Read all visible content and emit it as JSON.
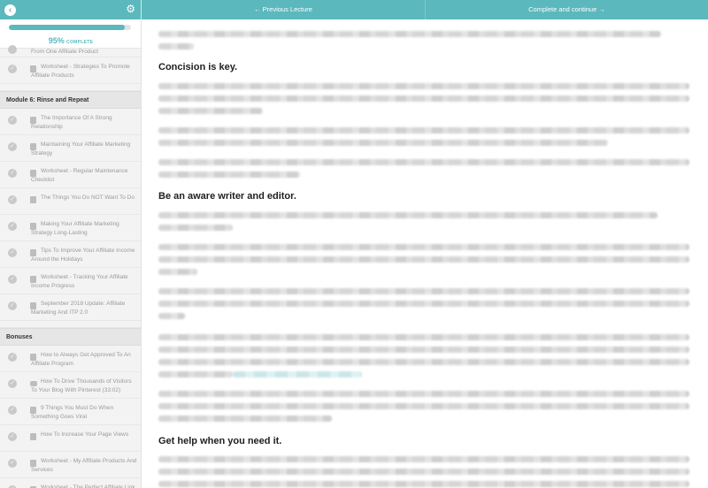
{
  "sidebar": {
    "progress": {
      "percent_label": "95%",
      "complete_label": "COMPLETE",
      "fraction": 0.95
    },
    "items": [
      {
        "kind": "partial",
        "title": "From One Affiliate Product"
      },
      {
        "kind": "lesson",
        "type": "text",
        "title": "Worksheet - Strategies To Promote Affiliate Products"
      },
      {
        "kind": "gap"
      },
      {
        "kind": "module",
        "title": "Module 6: Rinse and Repeat"
      },
      {
        "kind": "lesson",
        "type": "text",
        "title": "The Importance Of A Strong Relationship"
      },
      {
        "kind": "lesson",
        "type": "text",
        "title": "Maintaining Your Affiliate Marketing Strategy"
      },
      {
        "kind": "lesson",
        "type": "text",
        "title": "Worksheet - Regular Maintenance Checklist"
      },
      {
        "kind": "lesson",
        "type": "text",
        "title": "The Things You Do NOT Want To Do"
      },
      {
        "kind": "lesson",
        "type": "text",
        "title": "Making Your Affiliate Marketing Strategy Long-Lasting"
      },
      {
        "kind": "lesson",
        "type": "text",
        "title": "Tips To Improve Your Affiliate Income Around the Holidays"
      },
      {
        "kind": "lesson",
        "type": "text",
        "title": "Worksheet - Tracking Your Affiliate Income Progress"
      },
      {
        "kind": "lesson",
        "type": "text",
        "title": "September 2018 Update: Affiliate Marketing And ITP 2.0"
      },
      {
        "kind": "gap"
      },
      {
        "kind": "module",
        "title": "Bonuses"
      },
      {
        "kind": "lesson",
        "type": "text",
        "title": "How to Always Get Approved To An Affiliate Program"
      },
      {
        "kind": "lesson",
        "type": "video",
        "title": "How To Drive Thousands of Visitors To Your Blog With Pinterest (33:02)"
      },
      {
        "kind": "lesson",
        "type": "text",
        "title": "9 Things You Must Do When Something Goes Viral"
      },
      {
        "kind": "lesson",
        "type": "text",
        "title": "How To Increase Your Page Views"
      },
      {
        "kind": "lesson",
        "type": "text",
        "title": "Worksheet - My Affiliate Products And Services"
      },
      {
        "kind": "lesson",
        "type": "text",
        "title": "Worksheet - The Perfect Affiliate Link Checklist"
      }
    ]
  },
  "topbar": {
    "prev_label": "← Previous Lecture",
    "next_label": "Complete and continue →"
  },
  "content": {
    "headings": [
      "Concision is key.",
      "Be an aware writer and editor.",
      "Get help when you need it."
    ]
  },
  "colors": {
    "accent": "#5bb8bd"
  },
  "icons": {
    "back": "chevron-left-icon",
    "settings": "gear-icon",
    "check": "check-circle-icon",
    "text_lesson": "document-icon",
    "video_lesson": "video-icon"
  }
}
